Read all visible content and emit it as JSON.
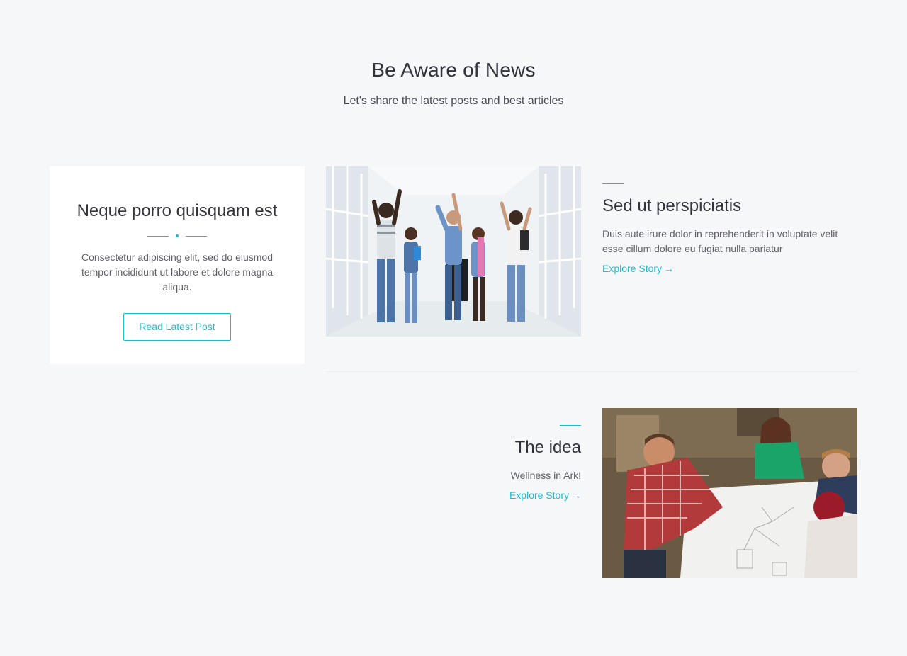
{
  "header": {
    "title": "Be Aware of News",
    "subtitle": "Let's share the latest posts and best articles"
  },
  "card": {
    "title": "Neque porro quisquam est",
    "text": "Consectetur adipiscing elit, sed do eiusmod tempor incididunt ut labore et dolore magna aliqua.",
    "button_label": "Read Latest Post"
  },
  "stories": [
    {
      "title": "Sed ut perspiciatis",
      "text": "Duis aute irure dolor in reprehenderit in voluptate velit esse cillum dolore eu fugiat nulla pariatur",
      "link_label": "Explore Story",
      "image_icon": "students-jumping-photo"
    },
    {
      "title": "The idea",
      "text": "Wellness in Ark!",
      "link_label": "Explore Story",
      "image_icon": "team-meeting-photo"
    }
  ],
  "colors": {
    "accent": "#17bed2",
    "background": "#f6f7f9",
    "card": "#ffffff",
    "text": "#34343c"
  },
  "icons": {
    "arrow": "→"
  }
}
